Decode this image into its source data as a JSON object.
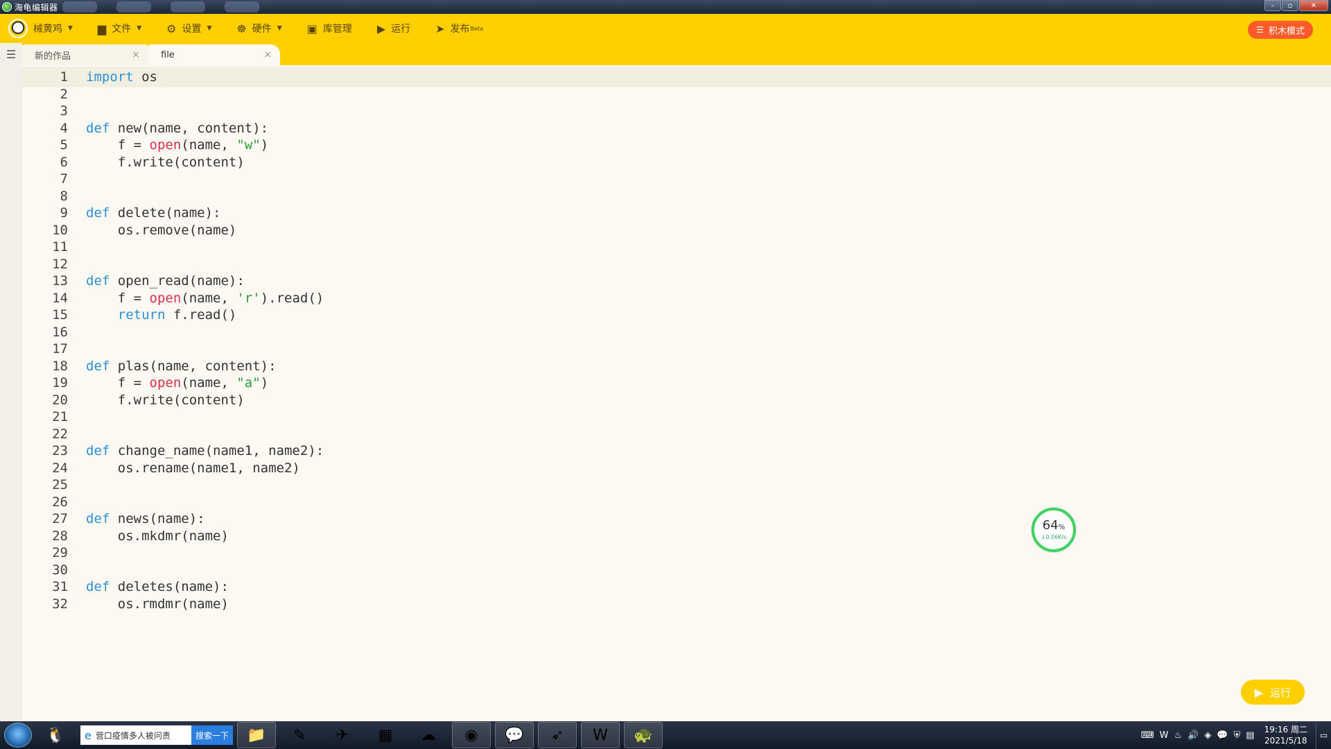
{
  "window": {
    "title": "海龟编辑器",
    "controls": {
      "minimize": "–",
      "maximize": "▫",
      "close": "✕"
    }
  },
  "toolbar": {
    "items": [
      {
        "icon": "duck-logo-icon",
        "label": "械黄鸡",
        "dropdown": true
      },
      {
        "icon": "folder-icon",
        "label": "文件",
        "dropdown": true
      },
      {
        "icon": "gear-icon",
        "label": "设置",
        "dropdown": true
      },
      {
        "icon": "hardware-icon",
        "label": "硬件",
        "dropdown": true
      },
      {
        "icon": "library-icon",
        "label": "库管理",
        "dropdown": false
      },
      {
        "icon": "play-circle-icon",
        "label": "运行",
        "dropdown": false
      },
      {
        "icon": "send-icon",
        "label": "发布",
        "badge": "Beta",
        "dropdown": false
      }
    ],
    "blocks_mode_label": "积木模式",
    "accent": "#ffd000"
  },
  "tabs": [
    {
      "label": "新的作品",
      "close": "×"
    },
    {
      "label": "file",
      "close": "×"
    }
  ],
  "editor": {
    "lines": [
      {
        "n": "1",
        "code": [
          [
            "kw",
            "import"
          ],
          [
            "t",
            " os"
          ]
        ]
      },
      {
        "n": "2",
        "code": []
      },
      {
        "n": "3",
        "code": []
      },
      {
        "n": "4",
        "code": [
          [
            "kw",
            "def"
          ],
          [
            "t",
            " new(name, content):"
          ]
        ]
      },
      {
        "n": "5",
        "code": [
          [
            "t",
            "    f = "
          ],
          [
            "bi",
            "open"
          ],
          [
            "t",
            "(name, "
          ],
          [
            "str",
            "\"w\""
          ],
          [
            "t",
            ")"
          ]
        ]
      },
      {
        "n": "6",
        "code": [
          [
            "t",
            "    f.write(content)"
          ]
        ]
      },
      {
        "n": "7",
        "code": []
      },
      {
        "n": "8",
        "code": []
      },
      {
        "n": "9",
        "code": [
          [
            "kw",
            "def"
          ],
          [
            "t",
            " delete(name):"
          ]
        ]
      },
      {
        "n": "10",
        "code": [
          [
            "t",
            "    os.remove(name)"
          ]
        ]
      },
      {
        "n": "11",
        "code": []
      },
      {
        "n": "12",
        "code": []
      },
      {
        "n": "13",
        "code": [
          [
            "kw",
            "def"
          ],
          [
            "t",
            " open_read(name):"
          ]
        ]
      },
      {
        "n": "14",
        "code": [
          [
            "t",
            "    f = "
          ],
          [
            "bi",
            "open"
          ],
          [
            "t",
            "(name, "
          ],
          [
            "str",
            "'r'"
          ],
          [
            "t",
            ").read()"
          ]
        ]
      },
      {
        "n": "15",
        "code": [
          [
            "t",
            "    "
          ],
          [
            "kw",
            "return"
          ],
          [
            "t",
            " f.read()"
          ]
        ]
      },
      {
        "n": "16",
        "code": []
      },
      {
        "n": "17",
        "code": []
      },
      {
        "n": "18",
        "code": [
          [
            "kw",
            "def"
          ],
          [
            "t",
            " plas(name, content):"
          ]
        ]
      },
      {
        "n": "19",
        "code": [
          [
            "t",
            "    f = "
          ],
          [
            "bi",
            "open"
          ],
          [
            "t",
            "(name, "
          ],
          [
            "str",
            "\"a\""
          ],
          [
            "t",
            ")"
          ]
        ]
      },
      {
        "n": "20",
        "code": [
          [
            "t",
            "    f.write(content)"
          ]
        ]
      },
      {
        "n": "21",
        "code": []
      },
      {
        "n": "22",
        "code": []
      },
      {
        "n": "23",
        "code": [
          [
            "kw",
            "def"
          ],
          [
            "t",
            " change_name(name1, name2):"
          ]
        ]
      },
      {
        "n": "24",
        "code": [
          [
            "t",
            "    os.rename(name1, name2)"
          ]
        ]
      },
      {
        "n": "25",
        "code": []
      },
      {
        "n": "26",
        "code": []
      },
      {
        "n": "27",
        "code": [
          [
            "kw",
            "def"
          ],
          [
            "t",
            " news(name):"
          ]
        ]
      },
      {
        "n": "28",
        "code": [
          [
            "t",
            "    os.mkdmr(name)"
          ]
        ]
      },
      {
        "n": "29",
        "code": []
      },
      {
        "n": "30",
        "code": []
      },
      {
        "n": "31",
        "code": [
          [
            "kw",
            "def"
          ],
          [
            "t",
            " deletes(name):"
          ]
        ]
      },
      {
        "n": "32",
        "code": [
          [
            "t",
            "    os.rmdmr(name)"
          ]
        ]
      }
    ],
    "colors": {
      "keyword": "#2d8fd6",
      "builtin": "#e0304a",
      "string": "#2a9a3a"
    }
  },
  "net_widget": {
    "percent": "64",
    "percent_sign": "%",
    "speed": "↓0.06K/s"
  },
  "run_button": {
    "label": "运行"
  },
  "taskbar": {
    "search_text": "营口疫情多人被问责",
    "search_button": "搜索一下",
    "clock_time": "19:16 周二",
    "clock_date": "2021/5/18"
  }
}
